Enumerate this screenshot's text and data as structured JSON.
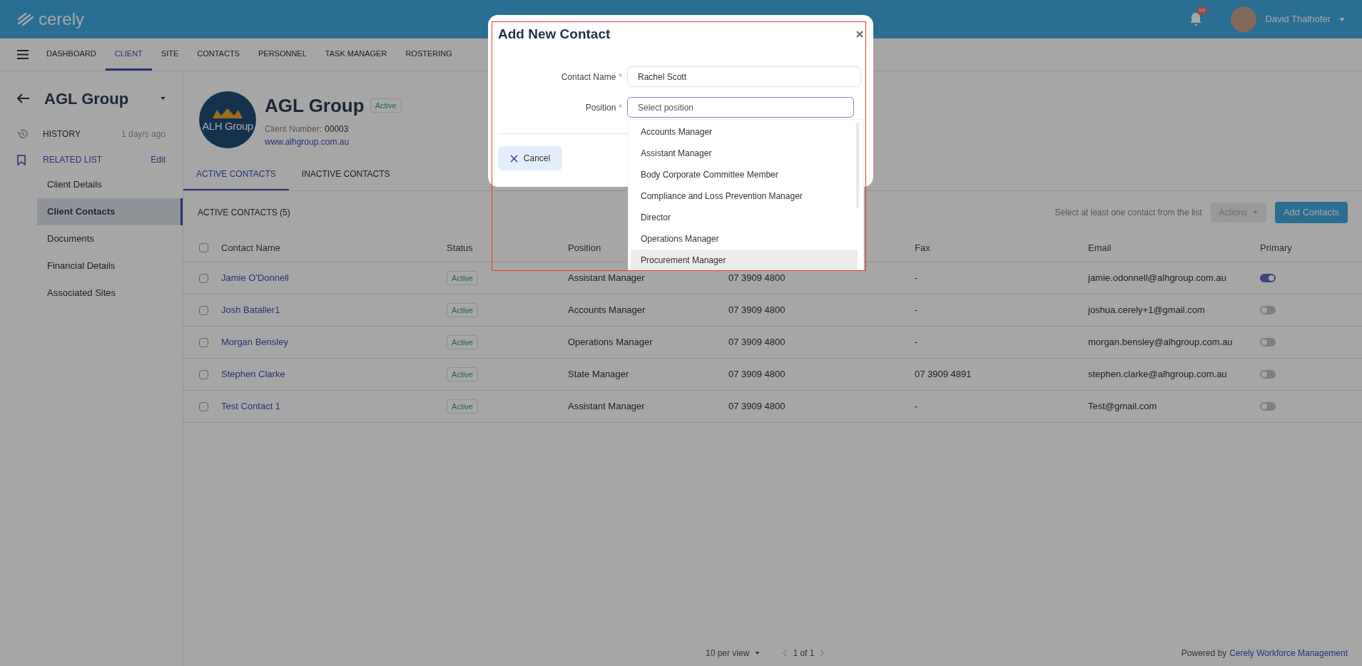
{
  "top_bar": {
    "logo": "cerely",
    "notification_count": "99",
    "user_name": "David Thalhofer"
  },
  "nav": [
    {
      "label": "DASHBOARD",
      "selected": false
    },
    {
      "label": "CLIENT",
      "selected": true
    },
    {
      "label": "SITE",
      "selected": false
    },
    {
      "label": "CONTACTS",
      "selected": false
    },
    {
      "label": "PERSONNEL",
      "selected": false
    },
    {
      "label": "TASK MANAGER",
      "selected": false
    },
    {
      "label": "ROSTERING",
      "selected": false
    }
  ],
  "sidebar": {
    "title": "AGL Group",
    "history": {
      "label": "HISTORY",
      "time": "1 day/s ago"
    },
    "related_list": {
      "label": "RELATED LIST",
      "edit": "Edit",
      "items": [
        {
          "label": "Client Details",
          "selected": false
        },
        {
          "label": "Client Contacts",
          "selected": true
        },
        {
          "label": "Documents",
          "selected": false
        },
        {
          "label": "Financial Details",
          "selected": false
        },
        {
          "label": "Associated Sites",
          "selected": false
        }
      ]
    }
  },
  "client": {
    "logo_text": "ALH Group",
    "name": "AGL Group",
    "status": "Active",
    "client_number_label": "Client Number:",
    "client_number": "00003",
    "website": "www.alhgroup.com.au"
  },
  "tabs": [
    {
      "label": "ACTIVE CONTACTS",
      "selected": true
    },
    {
      "label": "INACTIVE CONTACTS",
      "selected": false
    }
  ],
  "contacts": {
    "title": "ACTIVE CONTACTS (5)",
    "hint": "Select at least one contact from the list",
    "actions": {
      "label": "Actions",
      "disabled": true
    },
    "add_button": "Add Contacts",
    "select_all_checked": false,
    "columns": {
      "name": "Contact Name",
      "status": "Status",
      "position": "Position",
      "fax": "Fax",
      "email": "Email",
      "primary": "Primary"
    },
    "rows": [
      {
        "name": "Jamie O'Donnell",
        "status": "Active",
        "position": "Assistant Manager",
        "phone": "07 3909 4800",
        "fax": "-",
        "email": "jamie.odonnell@alhgroup.com.au",
        "primary": true,
        "checked": false
      },
      {
        "name": "Josh Bataller1",
        "status": "Active",
        "position": "Accounts Manager",
        "phone": "07 3909 4800",
        "fax": "-",
        "email": "joshua.cerely+1@gmail.com",
        "primary": false,
        "checked": false
      },
      {
        "name": "Morgan Bensley",
        "status": "Active",
        "position": "Operations Manager",
        "phone": "07 3909 4800",
        "fax": "-",
        "email": "morgan.bensley@alhgroup.com.au",
        "primary": false,
        "checked": false
      },
      {
        "name": "Stephen Clarke",
        "status": "Active",
        "position": "State Manager",
        "phone": "07 3909 4800",
        "fax": "07 3909 4891",
        "email": "stephen.clarke@alhgroup.com.au",
        "primary": false,
        "checked": false
      },
      {
        "name": "Test Contact 1",
        "status": "Active",
        "position": "Assistant Manager",
        "phone": "07 3909 4800",
        "fax": "-",
        "email": "Test@gmail.com",
        "primary": false,
        "checked": false
      }
    ]
  },
  "footer": {
    "per_view": "10 per view",
    "page": "1 of 1",
    "powered_by": "Powered by",
    "powered_link": "Cerely Workforce Management"
  },
  "dialog": {
    "title": "Add New Contact",
    "fields": [
      {
        "label": "Contact Name",
        "required_mark": "*",
        "value": "Rachel Scott"
      },
      {
        "label": "Position",
        "required_mark": "*",
        "placeholder": "Select position"
      }
    ],
    "options": [
      {
        "label": "Accounts Manager",
        "hovered": false
      },
      {
        "label": "Assistant Manager",
        "hovered": false
      },
      {
        "label": "Body Corporate Committee Member",
        "hovered": false
      },
      {
        "label": "Compliance and Loss Prevention Manager",
        "hovered": false
      },
      {
        "label": "Director",
        "hovered": false
      },
      {
        "label": "Operations Manager",
        "hovered": false
      },
      {
        "label": "Procurement Manager",
        "hovered": true
      }
    ],
    "cancel": "Cancel"
  }
}
